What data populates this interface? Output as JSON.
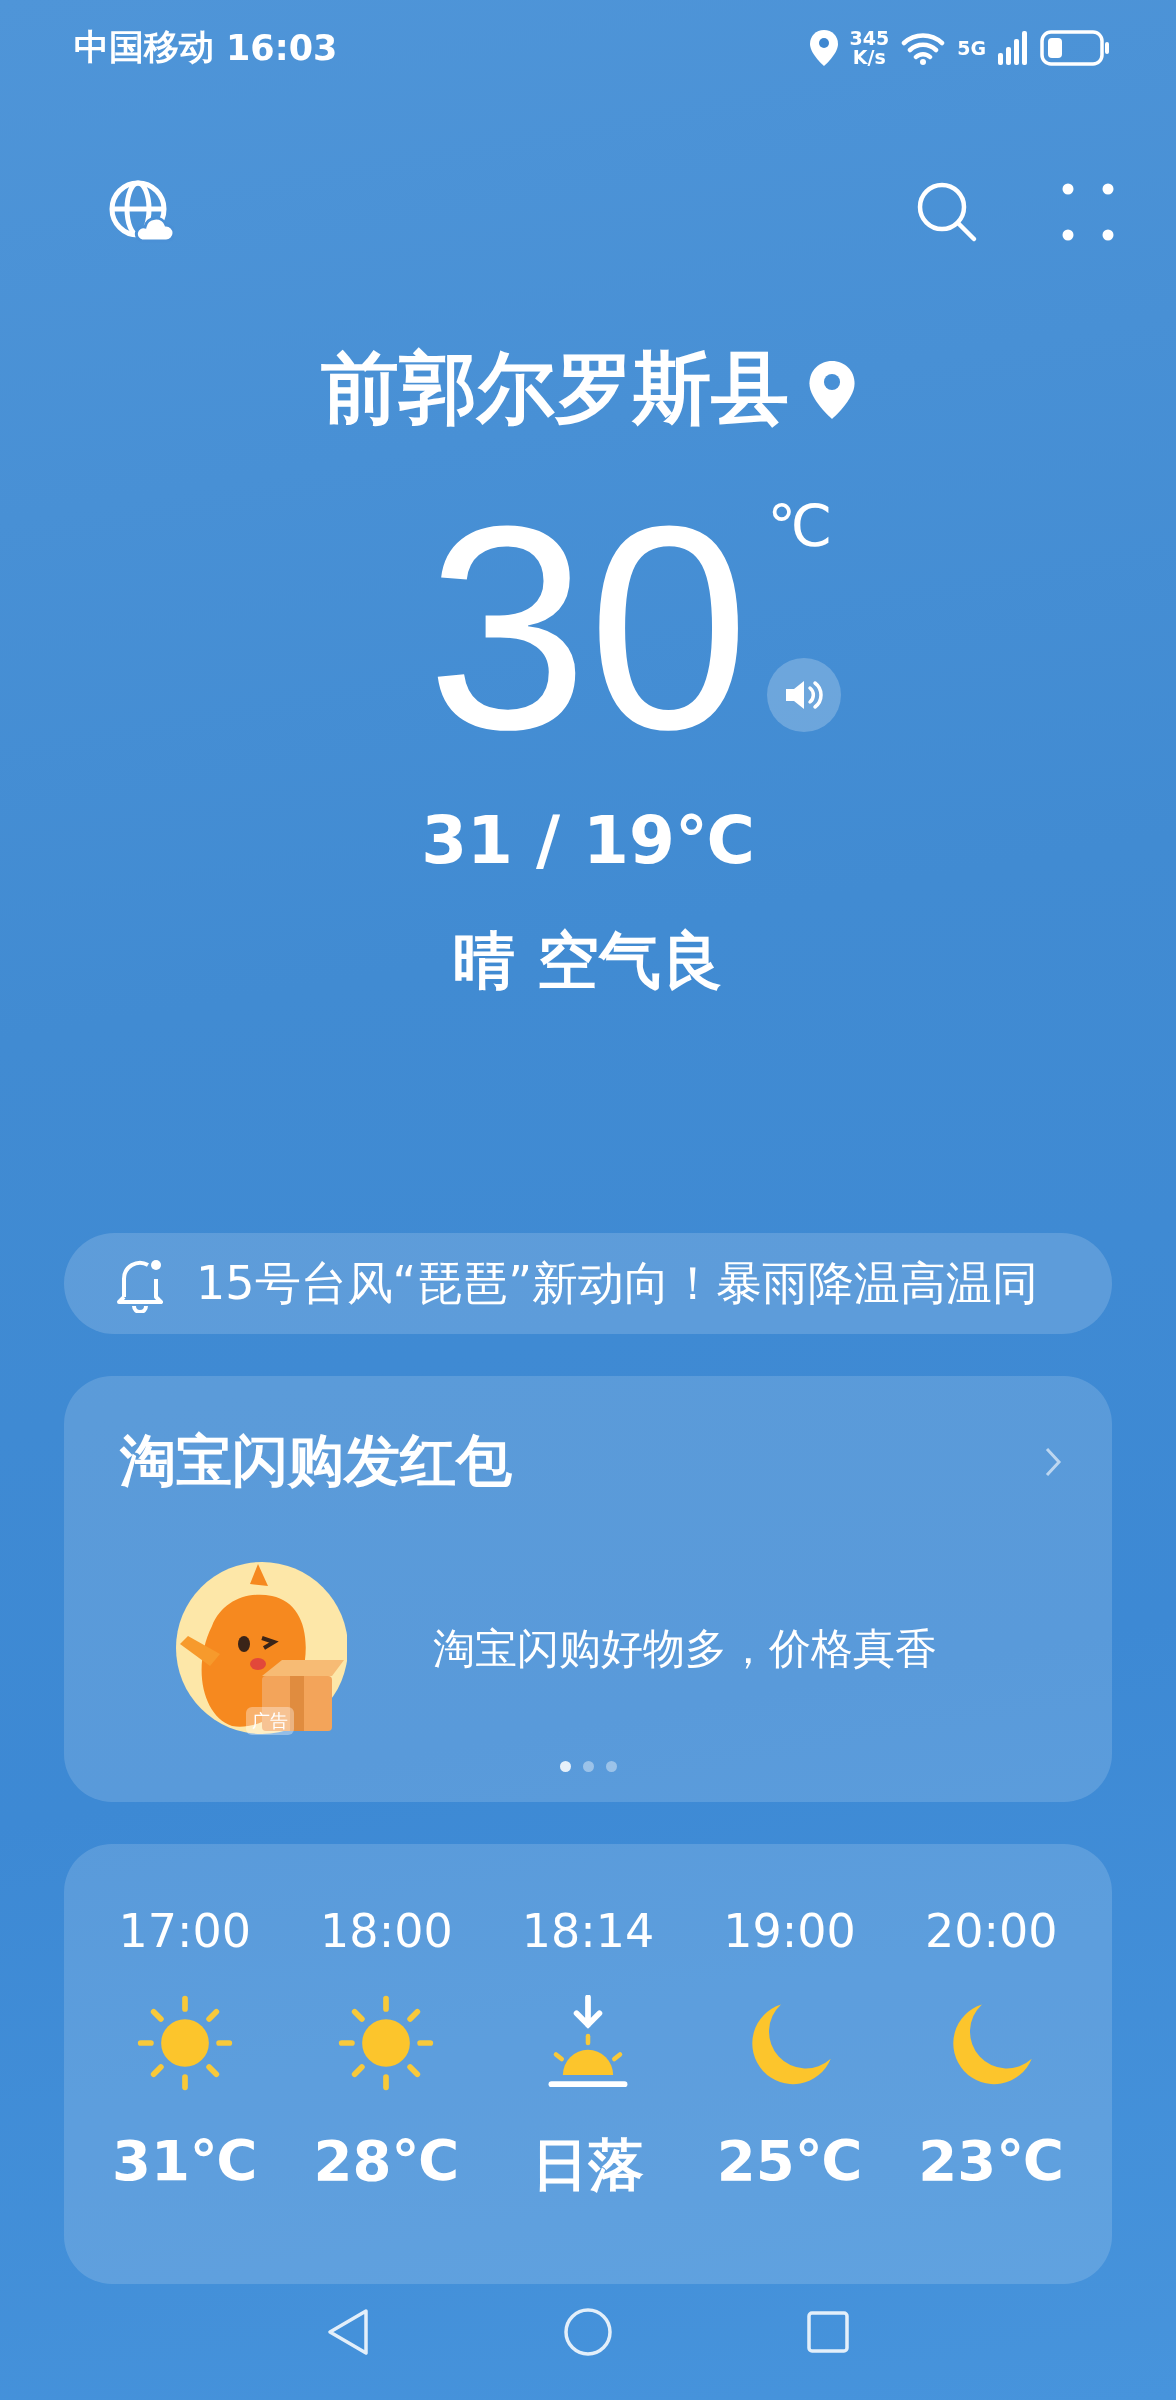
{
  "status_bar": {
    "carrier": "中国移动",
    "time": "16:03",
    "speed": "345",
    "speed_unit": "K/s",
    "network": "5G"
  },
  "location": {
    "city": "前郭尔罗斯县"
  },
  "current": {
    "temperature": "30",
    "unit": "℃",
    "range": "31 / 19℃",
    "condition": "晴 空气良"
  },
  "alert": {
    "text": "15号台风“琵琶”新动向！暴雨降温高温同"
  },
  "ad_card": {
    "title": "淘宝闪购发红包",
    "slogan": "淘宝闪购好物多，价格真香",
    "ad_label": "广告",
    "pages": [
      {
        "selected": true
      },
      {
        "selected": false
      },
      {
        "selected": false
      }
    ]
  },
  "hourly": [
    {
      "time": "17:00",
      "kind": "sun",
      "value": "31℃"
    },
    {
      "time": "18:00",
      "kind": "sun",
      "value": "28℃"
    },
    {
      "time": "18:14",
      "kind": "sunset",
      "value": "日落"
    },
    {
      "time": "19:00",
      "kind": "moon",
      "value": "25℃"
    },
    {
      "time": "20:00",
      "kind": "moon",
      "value": "23℃"
    }
  ]
}
